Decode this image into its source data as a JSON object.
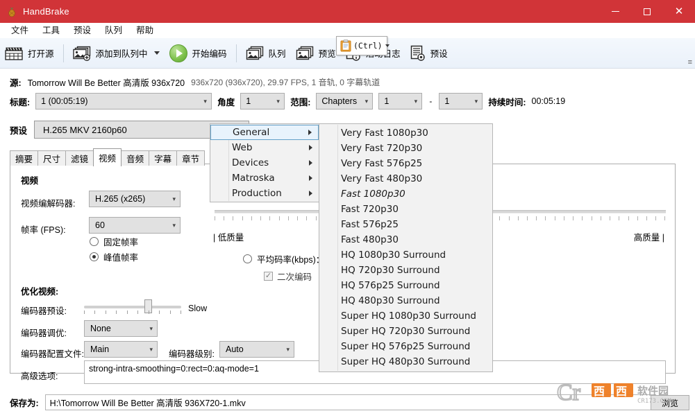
{
  "window": {
    "title": "HandBrake",
    "app_icon": "pineapple-icon",
    "minimize": "—",
    "maximize": "□",
    "close": "✕",
    "accent_color": "#d13438"
  },
  "menubar": {
    "items": [
      {
        "label": "文件",
        "name": "menu-file"
      },
      {
        "label": "工具",
        "name": "menu-tools"
      },
      {
        "label": "预设",
        "name": "menu-presets"
      },
      {
        "label": "队列",
        "name": "menu-queue"
      },
      {
        "label": "帮助",
        "name": "menu-help"
      }
    ]
  },
  "toolbar": {
    "open_source": "打开源",
    "add_to_queue": "添加到队列中",
    "start_encode": "开始编码",
    "queue": "队列",
    "preview": "预览",
    "activity_log": "活动日志",
    "presets": "预设",
    "overflow": "≡"
  },
  "paste_popup": {
    "text": "(Ctrl)",
    "icon": "clipboard-icon"
  },
  "source": {
    "label": "源:",
    "name": "Tomorrow Will Be Better 高清版 936x720",
    "meta": "936x720 (936x720), 29.97 FPS, 1 音轨, 0 字幕轨道"
  },
  "title_row": {
    "title_label": "标题:",
    "title_value": "1 (00:05:19)",
    "angle_label": "角度",
    "angle_value": "1",
    "range_label": "范围:",
    "range_value": "Chapters",
    "chapter_start": "1",
    "dash": "-",
    "chapter_end": "1",
    "duration_label": "持续时间:",
    "duration_value": "00:05:19"
  },
  "preset": {
    "label": "预设",
    "value": "H.265 MKV 2160p60"
  },
  "tabs": [
    {
      "label": "摘要",
      "name": "tab-summary",
      "active": false
    },
    {
      "label": "尺寸",
      "name": "tab-dimensions",
      "active": false
    },
    {
      "label": "滤镜",
      "name": "tab-filters",
      "active": false
    },
    {
      "label": "视频",
      "name": "tab-video",
      "active": true
    },
    {
      "label": "音频",
      "name": "tab-audio",
      "active": false
    },
    {
      "label": "字幕",
      "name": "tab-subtitles",
      "active": false
    },
    {
      "label": "章节",
      "name": "tab-chapters",
      "active": false
    }
  ],
  "video_tab": {
    "section_video": "视频",
    "codec_label": "视频编解码器:",
    "codec_value": "H.265 (x265)",
    "fps_label": "帧率 (FPS):",
    "fps_value": "60",
    "cfr_label": "固定帧率",
    "cfr_selected": false,
    "pfr_label": "峰值帧率",
    "pfr_selected": true,
    "quality_low": "低质量",
    "quality_high": "高质量",
    "avg_bitrate_label": "平均码率(kbps)：",
    "avg_bitrate_selected": false,
    "two_pass_label": "二次编码",
    "two_pass_checked": true,
    "section_optimize": "优化视频:",
    "encoder_preset_label": "编码器预设:",
    "encoder_preset_value": "Slow",
    "encoder_tune_label": "编码器调优:",
    "encoder_tune_value": "None",
    "encoder_profile_label": "编码器配置文件:",
    "encoder_profile_value": "Main",
    "encoder_level_label": "编码器级别:",
    "encoder_level_value": "Auto",
    "advanced_label": "高级选项:",
    "advanced_value": "strong-intra-smoothing=0:rect=0:aq-mode=1"
  },
  "presets_menu": {
    "categories": [
      {
        "label": "General",
        "selected": true
      },
      {
        "label": "Web",
        "selected": false
      },
      {
        "label": "Devices",
        "selected": false
      },
      {
        "label": "Matroska",
        "selected": false
      },
      {
        "label": "Production",
        "selected": false
      }
    ],
    "general_items": [
      {
        "label": "Very Fast 1080p30",
        "italic": false
      },
      {
        "label": "Very Fast 720p30",
        "italic": false
      },
      {
        "label": "Very Fast 576p25",
        "italic": false
      },
      {
        "label": "Very Fast 480p30",
        "italic": false
      },
      {
        "label": "Fast 1080p30",
        "italic": true
      },
      {
        "label": "Fast 720p30",
        "italic": false
      },
      {
        "label": "Fast 576p25",
        "italic": false
      },
      {
        "label": "Fast 480p30",
        "italic": false
      },
      {
        "label": "HQ 1080p30 Surround",
        "italic": false
      },
      {
        "label": "HQ 720p30 Surround",
        "italic": false
      },
      {
        "label": "HQ 576p25 Surround",
        "italic": false
      },
      {
        "label": "HQ 480p30 Surround",
        "italic": false
      },
      {
        "label": "Super HQ 1080p30 Surround",
        "italic": false
      },
      {
        "label": "Super HQ 720p30 Surround",
        "italic": false
      },
      {
        "label": "Super HQ 576p25 Surround",
        "italic": false
      },
      {
        "label": "Super HQ 480p30 Surround",
        "italic": false
      }
    ]
  },
  "save_row": {
    "label": "保存为:",
    "value": "H:\\Tomorrow Will Be Better 高清版 936X720-1.mkv",
    "browse": "浏览"
  },
  "watermark": {
    "brand": "西西软件园",
    "domain": "CR173.COM",
    "mark": "Cr"
  }
}
